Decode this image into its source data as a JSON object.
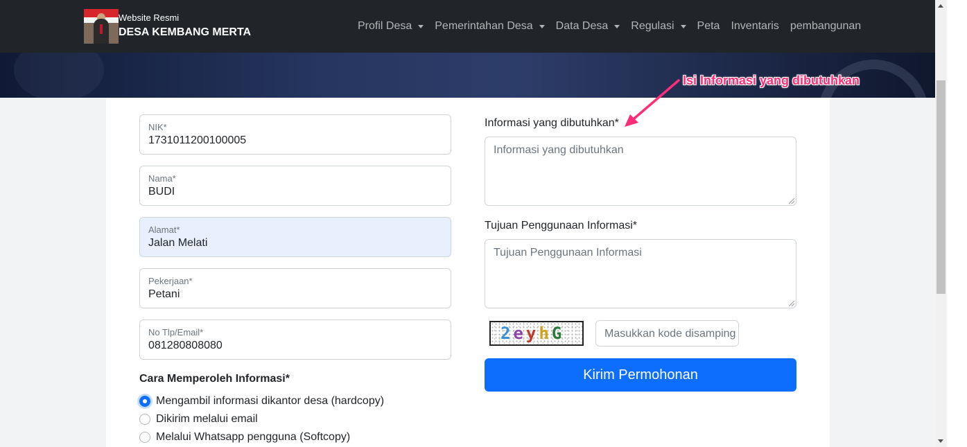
{
  "brand": {
    "subtitle": "Website Resmi",
    "title": "DESA KEMBANG MERTA"
  },
  "nav": [
    {
      "label": "Profil Desa",
      "dropdown": true
    },
    {
      "label": "Pemerintahan Desa",
      "dropdown": true
    },
    {
      "label": "Data Desa",
      "dropdown": true
    },
    {
      "label": "Regulasi",
      "dropdown": true
    },
    {
      "label": "Peta",
      "dropdown": false
    },
    {
      "label": "Inventaris",
      "dropdown": false
    },
    {
      "label": "pembangunan",
      "dropdown": false
    }
  ],
  "form": {
    "nik": {
      "label": "NIK*",
      "value": "1731011200100005"
    },
    "nama": {
      "label": "Nama*",
      "value": "BUDI"
    },
    "alamat": {
      "label": "Alamat*",
      "value": "Jalan Melati"
    },
    "pekerjaan": {
      "label": "Pekerjaan*",
      "value": "Petani"
    },
    "kontak": {
      "label": "No Tlp/Email*",
      "value": "081280808080"
    },
    "cara": {
      "heading": "Cara Memperoleh Informasi*",
      "options": [
        {
          "label": "Mengambil informasi dikantor desa (hardcopy)",
          "selected": true
        },
        {
          "label": "Dikirim melalui email",
          "selected": false
        },
        {
          "label": "Melalui Whatsapp pengguna (Softcopy)",
          "selected": false
        }
      ]
    },
    "informasi": {
      "label": "Informasi yang dibutuhkan*",
      "placeholder": "Informasi yang dibutuhkan"
    },
    "tujuan": {
      "label": "Tujuan Penggunaan Informasi*",
      "placeholder": "Tujuan Penggunaan Informasi"
    },
    "captcha": {
      "code": [
        "2",
        "e",
        "y",
        "h",
        "G"
      ],
      "placeholder": "Masukkan kode disamping"
    },
    "submit_label": "Kirim Permohonan"
  },
  "annotation": {
    "text": "Isi Informasi yang dibutuhkan",
    "color": "#ff2d78"
  },
  "colors": {
    "navbar": "#212529",
    "primary": "#0d6efd",
    "autofill": "#e8f0fe"
  }
}
